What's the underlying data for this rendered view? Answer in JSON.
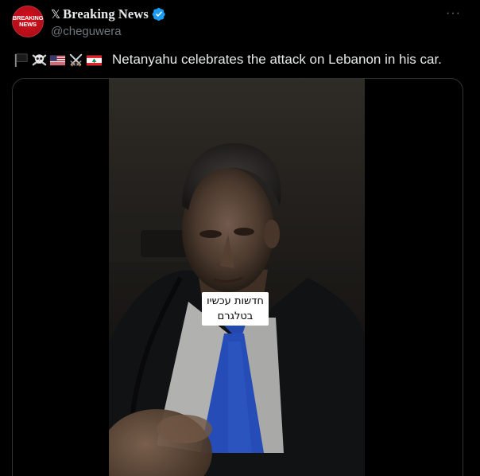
{
  "post": {
    "account_prefix": "𝕏",
    "display_name": "Breaking News",
    "handle": "@cheguwera",
    "more_label": "···",
    "avatar": {
      "line1": "BREAKING",
      "line2": "NEWS",
      "color": "#d9121f"
    },
    "verified_color": "#1d9bf0",
    "emojis": [
      "black-flag",
      "skull-and-crossbones",
      "us-flag",
      "crossed-swords",
      "lebanon-flag"
    ],
    "text": "Netanyahu celebrates the attack on Lebanon in his car.",
    "video": {
      "caption_line1": "חדשות עכשיו",
      "caption_line2": "בטלגרם"
    }
  }
}
